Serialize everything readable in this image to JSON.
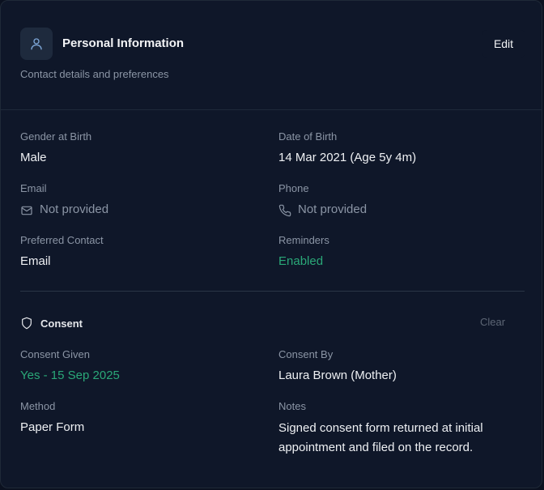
{
  "header": {
    "title": "Personal Information",
    "subtitle": "Contact details and preferences",
    "edit_label": "Edit",
    "icon": "user-icon"
  },
  "details": {
    "gender_label": "Gender at Birth",
    "gender_value": "Male",
    "dob_label": "Date of Birth",
    "dob_value": "14 Mar 2021 (Age 5y 4m)",
    "email_label": "Email",
    "email_value": "Not provided",
    "email_icon": "mail-icon",
    "phone_label": "Phone",
    "phone_value": "Not provided",
    "phone_icon": "phone-icon",
    "preferred_label": "Preferred Contact",
    "preferred_value": "Email",
    "reminders_label": "Reminders",
    "reminders_value": "Enabled"
  },
  "consent": {
    "title": "Consent",
    "icon": "shield-icon",
    "clear_label": "Clear",
    "given_label": "Consent Given",
    "given_value": "Yes - 15 Sep 2025",
    "by_label": "Consent By",
    "by_value": "Laura Brown (Mother)",
    "method_label": "Method",
    "method_value": "Paper Form",
    "notes_label": "Notes",
    "notes_value": "Signed consent form returned at initial appointment and filed on the record."
  },
  "colors": {
    "background": "#0f1729",
    "accent_green": "#2aa878",
    "muted_text": "#8b95a5"
  }
}
